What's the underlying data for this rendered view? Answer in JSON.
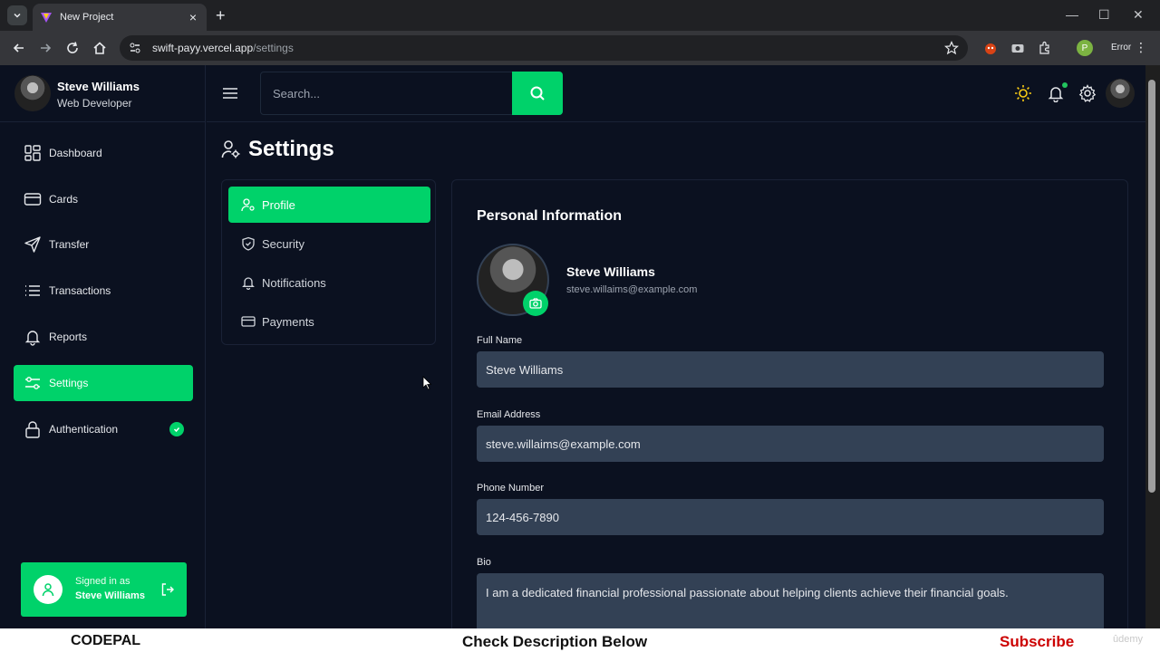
{
  "browser": {
    "tab_title": "New Project",
    "url_host": "swift-payy.vercel.app",
    "url_path": "/settings",
    "profile_initial": "P",
    "error_label": "Error"
  },
  "sidebar": {
    "user_name": "Steve Williams",
    "user_role": "Web Developer",
    "items": [
      {
        "label": "Dashboard",
        "icon": "dashboard-icon"
      },
      {
        "label": "Cards",
        "icon": "card-icon"
      },
      {
        "label": "Transfer",
        "icon": "send-icon"
      },
      {
        "label": "Transactions",
        "icon": "list-icon"
      },
      {
        "label": "Reports",
        "icon": "bell-icon"
      },
      {
        "label": "Settings",
        "icon": "settings-sliders-icon",
        "active": true
      },
      {
        "label": "Authentication",
        "icon": "lock-icon"
      }
    ],
    "signed_in_label": "Signed in as",
    "signed_in_name": "Steve Williams"
  },
  "header": {
    "search_placeholder": "Search..."
  },
  "main": {
    "title": "Settings",
    "settings_nav": [
      {
        "label": "Profile",
        "icon": "user-gear-icon",
        "active": true
      },
      {
        "label": "Security",
        "icon": "shield-icon"
      },
      {
        "label": "Notifications",
        "icon": "bell-icon"
      },
      {
        "label": "Payments",
        "icon": "card-icon"
      }
    ],
    "panel_title": "Personal Information",
    "profile_name": "Steve Williams",
    "profile_email": "steve.willaims@example.com",
    "fields": {
      "full_name_label": "Full Name",
      "full_name_value": "Steve Williams",
      "email_label": "Email Address",
      "email_value": "steve.willaims@example.com",
      "phone_label": "Phone Number",
      "phone_value": "124-456-7890",
      "bio_label": "Bio",
      "bio_value": "I am a dedicated financial professional passionate about helping clients achieve their financial goals."
    }
  },
  "banner": {
    "left": "CODEPAL",
    "middle": "Check Description Below",
    "right": "Subscribe",
    "watermark": "ûdemy"
  },
  "colors": {
    "accent": "#00d26a",
    "background": "#0b1120",
    "input_bg": "#334155"
  }
}
